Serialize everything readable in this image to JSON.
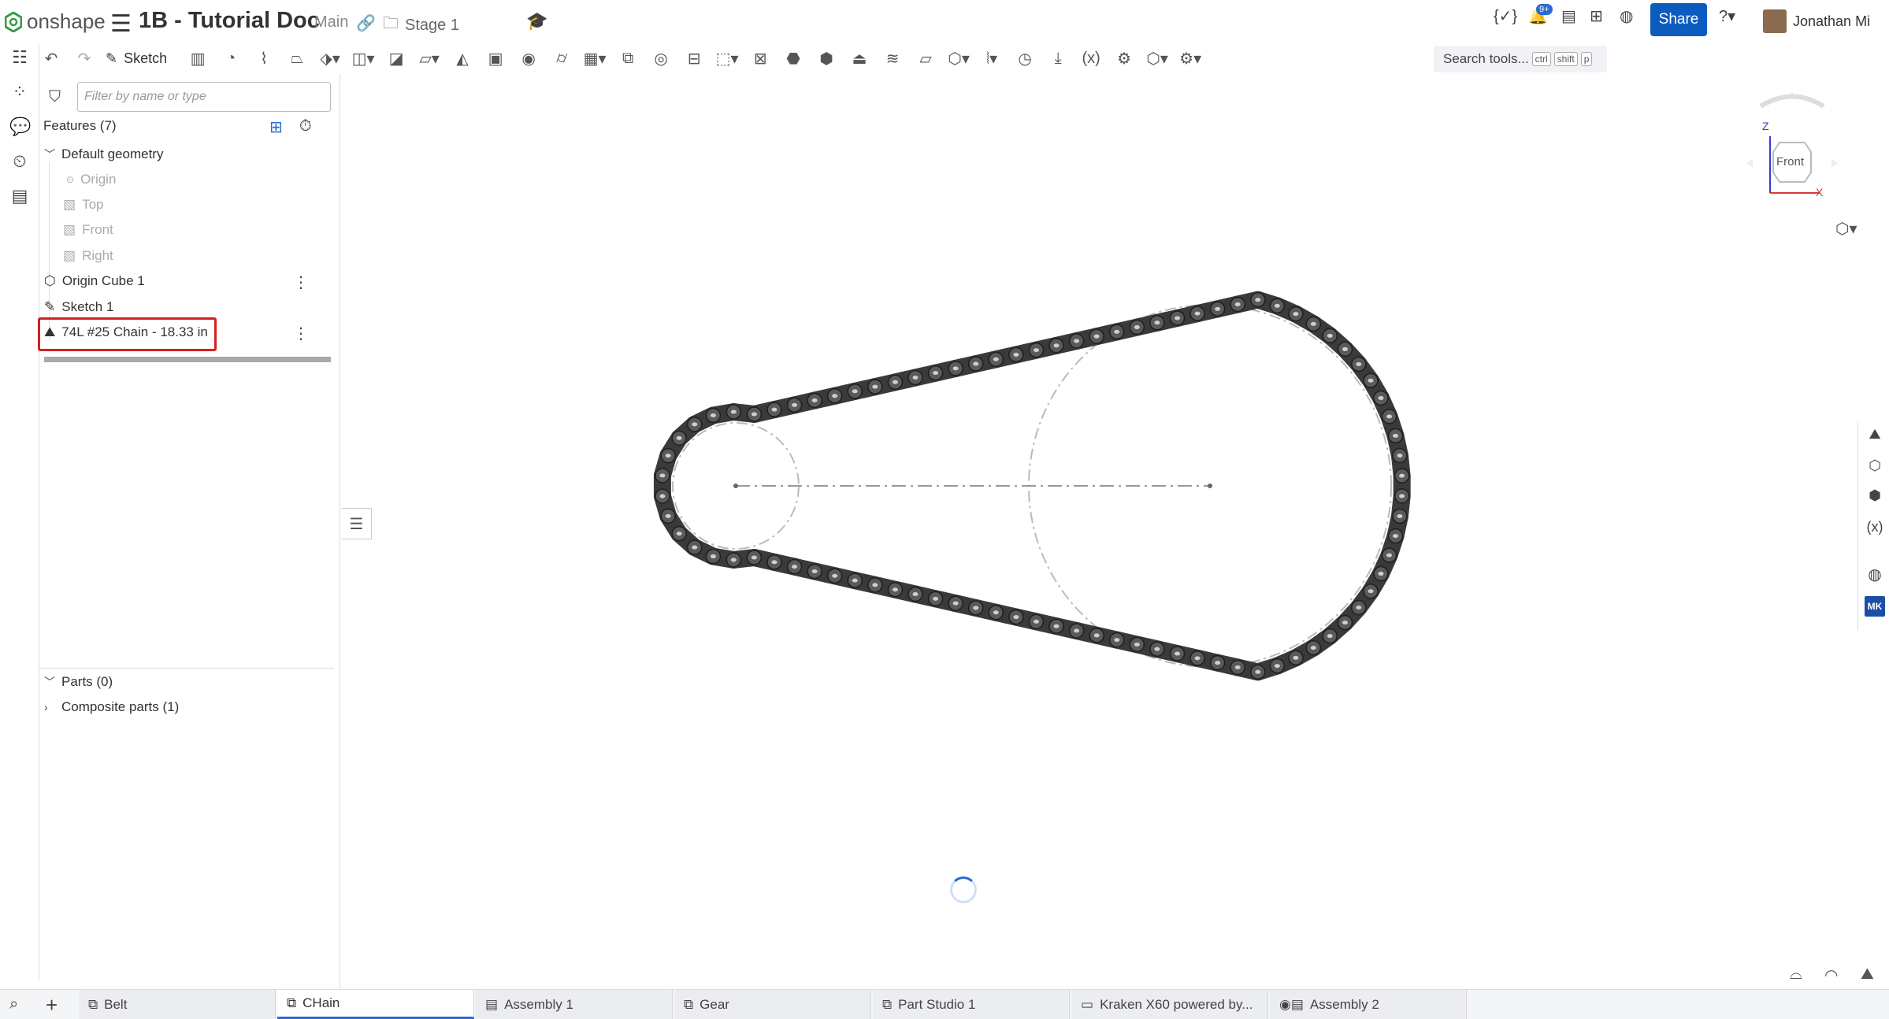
{
  "app": {
    "logo": "onshape"
  },
  "header": {
    "doc_title": "1B - Tutorial Doc",
    "branch": "Main",
    "folder": "Stage 1",
    "notifications_badge": "9+",
    "share_label": "Share",
    "user_name": "Jonathan Mi",
    "brand_color": "#0b5cbe"
  },
  "toolbar": {
    "sketch_label": "Sketch",
    "search_placeholder": "Search tools...",
    "kbd1": "ctrl",
    "kbd2": "shift",
    "kbd3": "p",
    "icons": [
      "undo-icon",
      "redo-icon",
      "sketch-icon",
      "extrude-icon",
      "revolve-icon",
      "sweep-icon",
      "loft-icon",
      "thicken-icon",
      "fillet-icon",
      "chamfer-icon",
      "draft-icon",
      "rib-icon",
      "shell-icon",
      "hole-icon",
      "cylinder-icon",
      "pattern-icon",
      "mirror-icon",
      "boolean-icon",
      "split-icon",
      "transform-icon",
      "delete-part-icon",
      "modify-fillet-icon",
      "move-face-icon",
      "replace-face-icon",
      "offset-surface-icon",
      "plane-icon",
      "mate-connector-icon",
      "helix-icon",
      "curve-icon",
      "measure-icon",
      "variable-icon",
      "configurator-icon",
      "custom-feature-icon",
      "display-icon"
    ]
  },
  "feature_panel": {
    "filter_placeholder": "Filter by name or type",
    "features_header": "Features (7)",
    "default_geometry": "Default geometry",
    "origin": "Origin",
    "top": "Top",
    "front": "Front",
    "right": "Right",
    "origin_cube": "Origin Cube 1",
    "sketch": "Sketch 1",
    "chain_feature": "74L #25 Chain - 18.33 in",
    "parts": "Parts (0)",
    "composite_parts": "Composite parts (1)"
  },
  "view_cube": {
    "face_label": "Front",
    "axis_z": "Z",
    "axis_x": "X"
  },
  "tabs": [
    {
      "label": "Belt"
    },
    {
      "label": "CHain"
    },
    {
      "label": "Assembly 1"
    },
    {
      "label": "Gear"
    },
    {
      "label": "Part Studio 1"
    },
    {
      "label": "Kraken X60 powered by..."
    },
    {
      "label": "Assembly 2"
    }
  ],
  "colors": {
    "highlight": "#d32020",
    "accent": "#2a6ad6"
  }
}
